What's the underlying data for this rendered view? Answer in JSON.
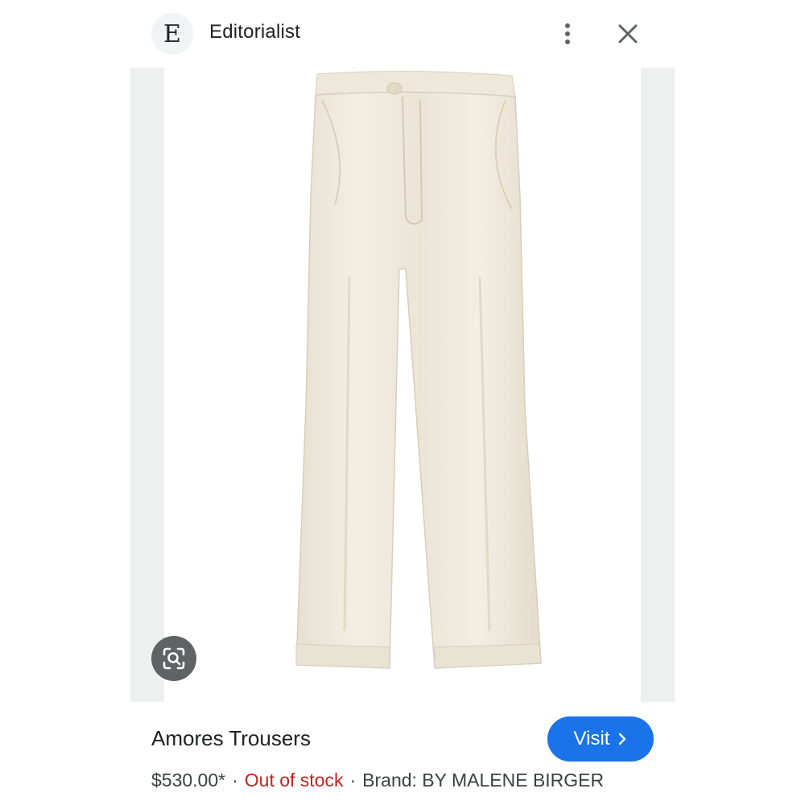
{
  "header": {
    "logo_letter": "E",
    "site_name": "Editorialist",
    "icons": [
      "more-vert-icon",
      "close-icon"
    ]
  },
  "product": {
    "image_icon": "trousers-image",
    "lens_icon": "lens-search-icon",
    "title": "Amores Trousers",
    "visit_label": "Visit",
    "visit_icon": "chevron-right-icon",
    "price": "$530.00*",
    "separator": "·",
    "stock_status": "Out of stock",
    "brand": "Brand: BY MALENE BIRGER"
  },
  "colors": {
    "accent": "#1a73e8",
    "stock_status": "#c5221f",
    "image_frame": "#eef0f0",
    "fabric": "#efeadc"
  }
}
